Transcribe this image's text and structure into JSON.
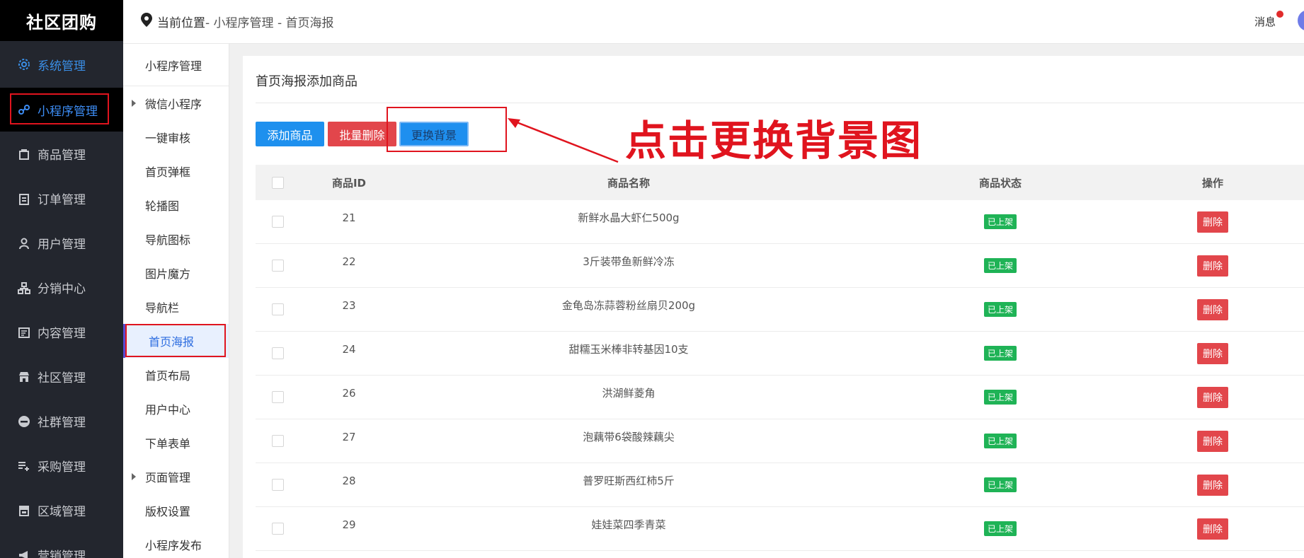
{
  "app": {
    "brand": "社区团购"
  },
  "sidebar": {
    "items": [
      {
        "label": "系统管理",
        "icon": "gear-icon"
      },
      {
        "label": "小程序管理",
        "icon": "link-icon"
      },
      {
        "label": "商品管理",
        "icon": "bag-icon"
      },
      {
        "label": "订单管理",
        "icon": "clipboard-icon"
      },
      {
        "label": "用户管理",
        "icon": "user-icon"
      },
      {
        "label": "分销中心",
        "icon": "sitemap-icon"
      },
      {
        "label": "内容管理",
        "icon": "document-icon"
      },
      {
        "label": "社区管理",
        "icon": "store-icon"
      },
      {
        "label": "社群管理",
        "icon": "minus-circle-icon"
      },
      {
        "label": "采购管理",
        "icon": "list-plus-icon"
      },
      {
        "label": "区域管理",
        "icon": "shop-icon"
      },
      {
        "label": "营销管理",
        "icon": "megaphone-icon"
      }
    ]
  },
  "submenu": {
    "title": "小程序管理",
    "items": [
      {
        "label": "微信小程序",
        "caret": true
      },
      {
        "label": "一键审核"
      },
      {
        "label": "首页弹框"
      },
      {
        "label": "轮播图"
      },
      {
        "label": "导航图标"
      },
      {
        "label": "图片魔方"
      },
      {
        "label": "导航栏"
      },
      {
        "label": "首页海报",
        "active": true
      },
      {
        "label": "首页布局"
      },
      {
        "label": "用户中心"
      },
      {
        "label": "下单表单"
      },
      {
        "label": "页面管理",
        "caret": true
      },
      {
        "label": "版权设置"
      },
      {
        "label": "小程序发布"
      }
    ]
  },
  "header": {
    "breadcrumb_lead": "当前位置",
    "breadcrumb_rest": " - 小程序管理 - 首页海报",
    "messages_label": "消息"
  },
  "main": {
    "title": "首页海报添加商品",
    "buttons": {
      "add": "添加商品",
      "batch_delete": "批量删除",
      "change_bg": "更换背景"
    },
    "annotation": "点击更换背景图",
    "table": {
      "headers": {
        "id": "商品ID",
        "name": "商品名称",
        "status": "商品状态",
        "op": "操作"
      },
      "rows": [
        {
          "id": "21",
          "name": "新鲜水晶大虾仁500g",
          "status": "已上架",
          "op": "删除"
        },
        {
          "id": "22",
          "name": "3斤装带鱼新鲜冷冻",
          "status": "已上架",
          "op": "删除"
        },
        {
          "id": "23",
          "name": "金龟岛冻蒜蓉粉丝扇贝200g",
          "status": "已上架",
          "op": "删除"
        },
        {
          "id": "24",
          "name": "甜糯玉米棒非转基因10支",
          "status": "已上架",
          "op": "删除"
        },
        {
          "id": "26",
          "name": "洪湖鲜菱角",
          "status": "已上架",
          "op": "删除"
        },
        {
          "id": "27",
          "name": "泡藕带6袋酸辣藕尖",
          "status": "已上架",
          "op": "删除"
        },
        {
          "id": "28",
          "name": "普罗旺斯西红柿5斤",
          "status": "已上架",
          "op": "删除"
        },
        {
          "id": "29",
          "name": "娃娃菜四季青菜",
          "status": "已上架",
          "op": "删除"
        }
      ]
    }
  },
  "colors": {
    "primary": "#1e90ee",
    "danger": "#e2464b",
    "success": "#1fb356",
    "sidebar_bg": "#23262e",
    "highlight_outline": "#e0141e"
  }
}
